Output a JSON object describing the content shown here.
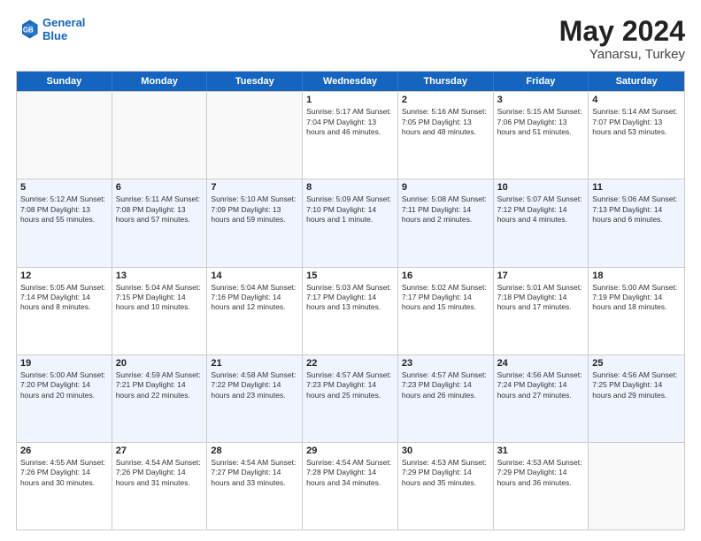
{
  "header": {
    "logo_line1": "General",
    "logo_line2": "Blue",
    "main_title": "May 2024",
    "subtitle": "Yanarsu, Turkey"
  },
  "days_of_week": [
    "Sunday",
    "Monday",
    "Tuesday",
    "Wednesday",
    "Thursday",
    "Friday",
    "Saturday"
  ],
  "rows": [
    {
      "cells": [
        {
          "day": "",
          "info": "",
          "empty": true
        },
        {
          "day": "",
          "info": "",
          "empty": true
        },
        {
          "day": "",
          "info": "",
          "empty": true
        },
        {
          "day": "1",
          "info": "Sunrise: 5:17 AM\nSunset: 7:04 PM\nDaylight: 13 hours\nand 46 minutes."
        },
        {
          "day": "2",
          "info": "Sunrise: 5:16 AM\nSunset: 7:05 PM\nDaylight: 13 hours\nand 48 minutes."
        },
        {
          "day": "3",
          "info": "Sunrise: 5:15 AM\nSunset: 7:06 PM\nDaylight: 13 hours\nand 51 minutes."
        },
        {
          "day": "4",
          "info": "Sunrise: 5:14 AM\nSunset: 7:07 PM\nDaylight: 13 hours\nand 53 minutes."
        }
      ]
    },
    {
      "alt": true,
      "cells": [
        {
          "day": "5",
          "info": "Sunrise: 5:12 AM\nSunset: 7:08 PM\nDaylight: 13 hours\nand 55 minutes."
        },
        {
          "day": "6",
          "info": "Sunrise: 5:11 AM\nSunset: 7:08 PM\nDaylight: 13 hours\nand 57 minutes."
        },
        {
          "day": "7",
          "info": "Sunrise: 5:10 AM\nSunset: 7:09 PM\nDaylight: 13 hours\nand 59 minutes."
        },
        {
          "day": "8",
          "info": "Sunrise: 5:09 AM\nSunset: 7:10 PM\nDaylight: 14 hours\nand 1 minute."
        },
        {
          "day": "9",
          "info": "Sunrise: 5:08 AM\nSunset: 7:11 PM\nDaylight: 14 hours\nand 2 minutes."
        },
        {
          "day": "10",
          "info": "Sunrise: 5:07 AM\nSunset: 7:12 PM\nDaylight: 14 hours\nand 4 minutes."
        },
        {
          "day": "11",
          "info": "Sunrise: 5:06 AM\nSunset: 7:13 PM\nDaylight: 14 hours\nand 6 minutes."
        }
      ]
    },
    {
      "cells": [
        {
          "day": "12",
          "info": "Sunrise: 5:05 AM\nSunset: 7:14 PM\nDaylight: 14 hours\nand 8 minutes."
        },
        {
          "day": "13",
          "info": "Sunrise: 5:04 AM\nSunset: 7:15 PM\nDaylight: 14 hours\nand 10 minutes."
        },
        {
          "day": "14",
          "info": "Sunrise: 5:04 AM\nSunset: 7:16 PM\nDaylight: 14 hours\nand 12 minutes."
        },
        {
          "day": "15",
          "info": "Sunrise: 5:03 AM\nSunset: 7:17 PM\nDaylight: 14 hours\nand 13 minutes."
        },
        {
          "day": "16",
          "info": "Sunrise: 5:02 AM\nSunset: 7:17 PM\nDaylight: 14 hours\nand 15 minutes."
        },
        {
          "day": "17",
          "info": "Sunrise: 5:01 AM\nSunset: 7:18 PM\nDaylight: 14 hours\nand 17 minutes."
        },
        {
          "day": "18",
          "info": "Sunrise: 5:00 AM\nSunset: 7:19 PM\nDaylight: 14 hours\nand 18 minutes."
        }
      ]
    },
    {
      "alt": true,
      "cells": [
        {
          "day": "19",
          "info": "Sunrise: 5:00 AM\nSunset: 7:20 PM\nDaylight: 14 hours\nand 20 minutes."
        },
        {
          "day": "20",
          "info": "Sunrise: 4:59 AM\nSunset: 7:21 PM\nDaylight: 14 hours\nand 22 minutes."
        },
        {
          "day": "21",
          "info": "Sunrise: 4:58 AM\nSunset: 7:22 PM\nDaylight: 14 hours\nand 23 minutes."
        },
        {
          "day": "22",
          "info": "Sunrise: 4:57 AM\nSunset: 7:23 PM\nDaylight: 14 hours\nand 25 minutes."
        },
        {
          "day": "23",
          "info": "Sunrise: 4:57 AM\nSunset: 7:23 PM\nDaylight: 14 hours\nand 26 minutes."
        },
        {
          "day": "24",
          "info": "Sunrise: 4:56 AM\nSunset: 7:24 PM\nDaylight: 14 hours\nand 27 minutes."
        },
        {
          "day": "25",
          "info": "Sunrise: 4:56 AM\nSunset: 7:25 PM\nDaylight: 14 hours\nand 29 minutes."
        }
      ]
    },
    {
      "cells": [
        {
          "day": "26",
          "info": "Sunrise: 4:55 AM\nSunset: 7:26 PM\nDaylight: 14 hours\nand 30 minutes."
        },
        {
          "day": "27",
          "info": "Sunrise: 4:54 AM\nSunset: 7:26 PM\nDaylight: 14 hours\nand 31 minutes."
        },
        {
          "day": "28",
          "info": "Sunrise: 4:54 AM\nSunset: 7:27 PM\nDaylight: 14 hours\nand 33 minutes."
        },
        {
          "day": "29",
          "info": "Sunrise: 4:54 AM\nSunset: 7:28 PM\nDaylight: 14 hours\nand 34 minutes."
        },
        {
          "day": "30",
          "info": "Sunrise: 4:53 AM\nSunset: 7:29 PM\nDaylight: 14 hours\nand 35 minutes."
        },
        {
          "day": "31",
          "info": "Sunrise: 4:53 AM\nSunset: 7:29 PM\nDaylight: 14 hours\nand 36 minutes."
        },
        {
          "day": "",
          "info": "",
          "empty": true
        }
      ]
    }
  ]
}
